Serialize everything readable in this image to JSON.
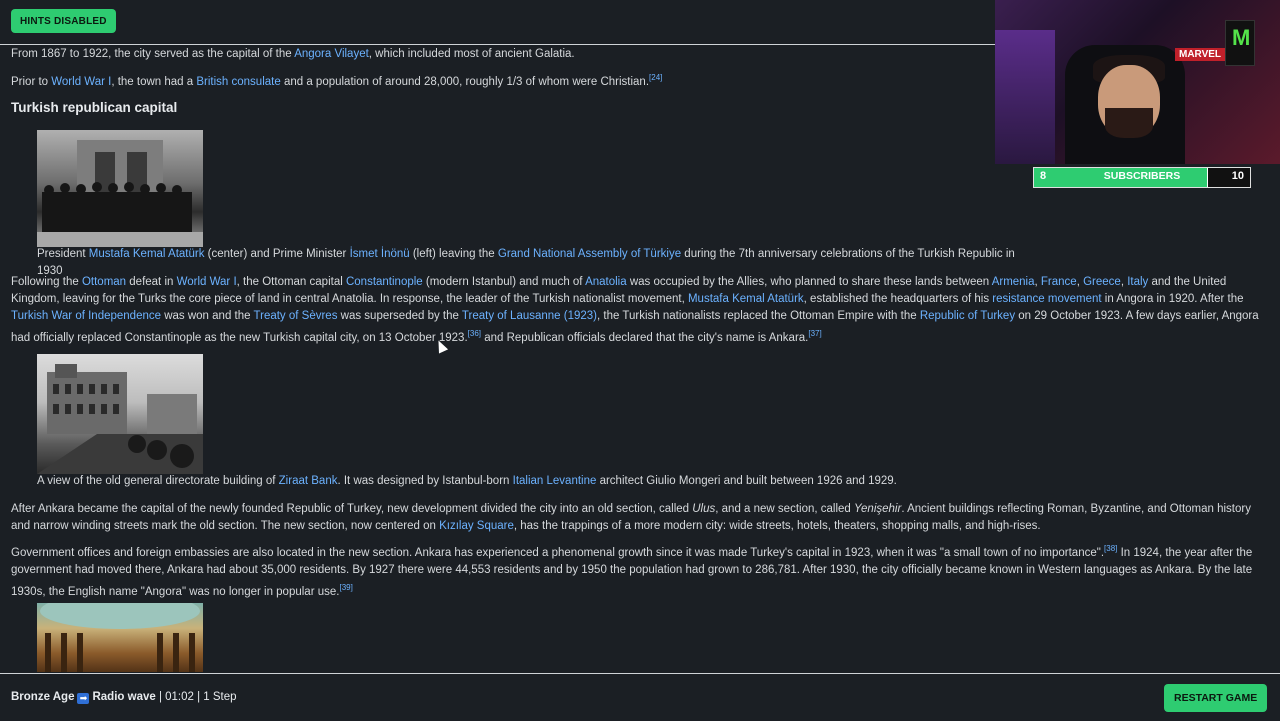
{
  "hints_button": "HINTS DISABLED",
  "para1": {
    "t1": "From 1867 to 1922, the city served as the capital of the ",
    "l1": "Angora Vilayet",
    "t2": ", which included most of ancient Galatia."
  },
  "para2": {
    "t1": "Prior to ",
    "l1": "World War I",
    "t2": ", the town had a ",
    "l2": "British consulate",
    "t3": " and a population of around 28,000, roughly ",
    "frac": "1/3",
    "t4": " of whom were Christian.",
    "ref": "[24]"
  },
  "section_heading": "Turkish republican capital",
  "caption1": {
    "t1": "President ",
    "l1": "Mustafa Kemal Atatürk",
    "t2": " (center) and Prime Minister ",
    "l2": "İsmet İnönü",
    "t3": " (left) leaving the ",
    "l3": "Grand National Assembly of Türkiye",
    "t4": " during the 7th anniversary celebrations of the Turkish Republic in 1930"
  },
  "para3": {
    "t1": "Following the ",
    "l1": "Ottoman",
    "t2": " defeat in ",
    "l2": "World War I",
    "t3": ", the Ottoman capital ",
    "l3": "Constantinople",
    "t4": " (modern Istanbul) and much of ",
    "l4": "Anatolia",
    "t5": " was occupied by the Allies, who planned to share these lands between ",
    "l5": "Armenia",
    "t6": ", ",
    "l6": "France",
    "t7": ", ",
    "l7": "Greece",
    "t8": ", ",
    "l8": "Italy",
    "t9": " and the United Kingdom, leaving for the Turks the core piece of land in central Anatolia. In response, the leader of the Turkish nationalist movement, ",
    "l9": "Mustafa Kemal Atatürk",
    "t10": ", established the headquarters of his ",
    "l10": "resistance movement",
    "t11": " in Angora in 1920. After the ",
    "l11": "Turkish War of Independence",
    "t12": " was won and the ",
    "l12": "Treaty of Sèvres",
    "t13": " was superseded by the ",
    "l13": "Treaty of Lausanne (1923)",
    "t14": ", the Turkish nationalists replaced the Ottoman Empire with the ",
    "l14": "Republic of Turkey",
    "t15": " on 29 October 1923. A few days earlier, Angora had officially replaced Constantinople as the new Turkish capital city, on 13 October 1923.",
    "ref1": "[36]",
    "t16": " and Republican officials declared that the city's name is Ankara.",
    "ref2": "[37]"
  },
  "caption2": {
    "t1": "A view of the old general directorate building of ",
    "l1": "Ziraat Bank",
    "t2": ". It was designed by Istanbul-born ",
    "l2": "Italian Levantine",
    "t3": " architect Giulio Mongeri and built between 1926 and 1929."
  },
  "para4": {
    "t1": "After Ankara became the capital of the newly founded Republic of Turkey, new development divided the city into an old section, called ",
    "i1": "Ulus",
    "t2": ", and a new section, called ",
    "i2": "Yenişehir",
    "t3": ". Ancient buildings reflecting Roman, Byzantine, and Ottoman history and narrow winding streets mark the old section. The new section, now centered on ",
    "l1": "Kızılay Square",
    "t4": ", has the trappings of a more modern city: wide streets, hotels, theaters, shopping malls, and high-rises."
  },
  "para5": {
    "t1": "Government offices and foreign embassies are also located in the new section. Ankara has experienced a phenomenal growth since it was made Turkey's capital in 1923, when it was \"a small town of no importance\".",
    "ref1": "[38]",
    "t2": " In 1924, the year after the government had moved there, Ankara had about 35,000 residents. By 1927 there were 44,553 residents and by 1950 the population had grown to 286,781. After 1930, the city officially became known in Western languages as Ankara. By the late 1930s, the English name \"Angora\" was no longer in popular use.",
    "ref2": "[39]"
  },
  "subscribers": {
    "label": "SUBSCRIBERS",
    "current": "8",
    "goal": "10",
    "progress": 0.8
  },
  "webcam": {
    "sign": "MARVEL",
    "can_glyph": "M"
  },
  "footer": {
    "start": "Bronze Age",
    "arrow_glyph": "➡",
    "target": "Radio wave",
    "stats": " | 01:02 | 1 Step",
    "restart": "RESTART GAME"
  }
}
